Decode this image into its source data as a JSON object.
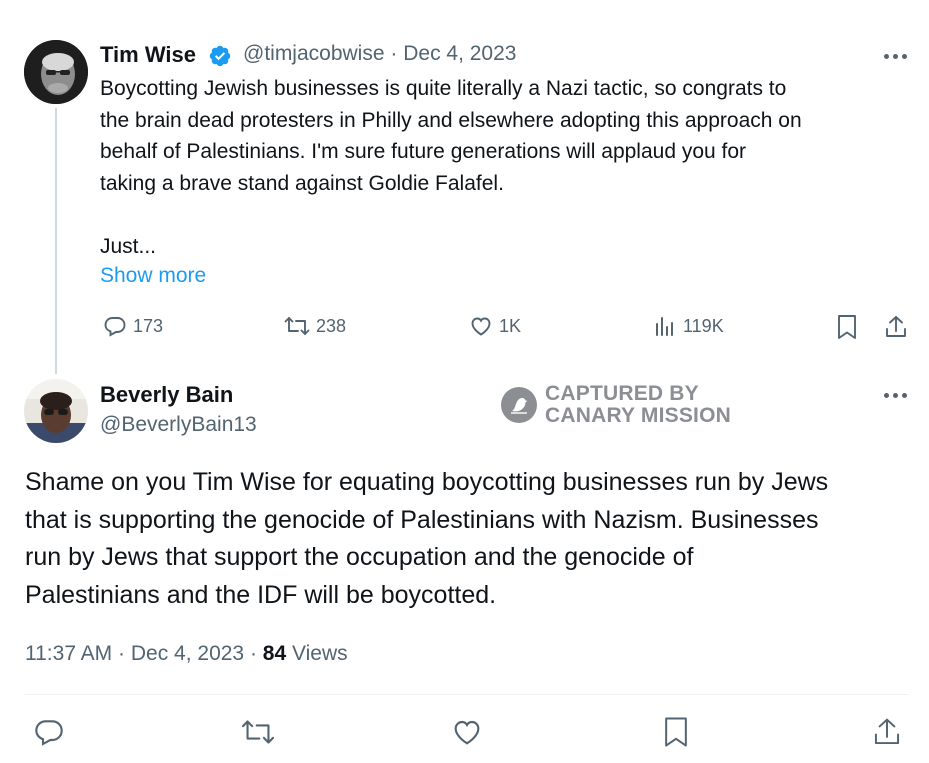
{
  "original_tweet": {
    "author_name": "Tim Wise",
    "verified": true,
    "handle": "@timjacobwise",
    "separator": "·",
    "date": "Dec 4, 2023",
    "text_lines": [
      "Boycotting Jewish businesses is quite literally a Nazi tactic, so congrats to",
      "the brain dead protesters in Philly and elsewhere adopting this approach on",
      "behalf of Palestinians. I'm sure future generations will applaud you for",
      "taking a brave stand against Goldie Falafel."
    ],
    "text_tail": "Just...",
    "show_more_label": "Show more",
    "stats": {
      "replies": "173",
      "reposts": "238",
      "likes": "1K",
      "views": "119K"
    }
  },
  "reply_tweet": {
    "author_name": "Beverly Bain",
    "handle": "@BeverlyBain13",
    "text_lines": [
      "Shame on you Tim Wise for equating boycotting businesses run by Jews",
      "that is supporting the genocide of Palestinians with Nazism. Businesses",
      "run by Jews that support the occupation and the genocide of",
      "Palestinians and the IDF will be boycotted."
    ],
    "time": "11:37 AM",
    "date": "Dec 4, 2023",
    "views_count": "84",
    "views_label": "Views"
  },
  "watermark": {
    "line1": "CAPTURED BY",
    "line2": "CANARY MISSION"
  },
  "colors": {
    "accent": "#1d9bf0",
    "text": "#0f1419",
    "muted": "#536471",
    "divider": "#eff3f4"
  }
}
